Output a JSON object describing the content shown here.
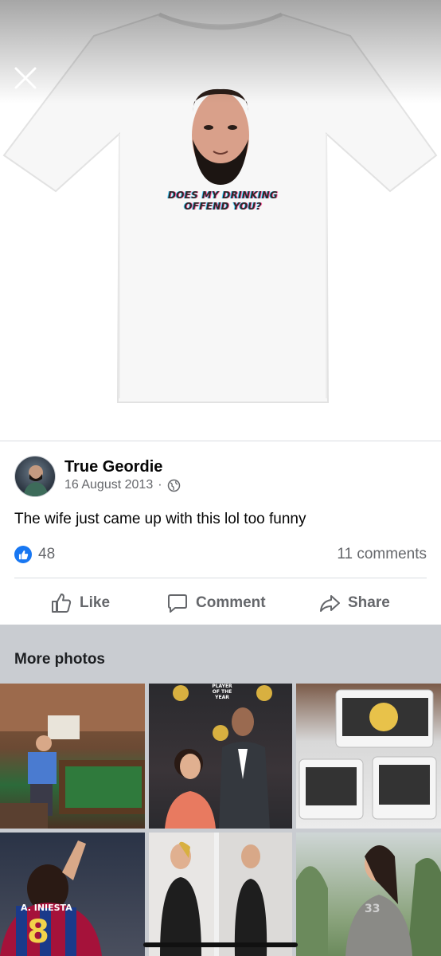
{
  "photo": {
    "shirt_text": "DOES MY DRINKING OFFEND YOU?"
  },
  "post": {
    "author": "True Geordie",
    "date": "16 August 2013",
    "separator": "·",
    "privacy_icon": "globe-icon",
    "text": "The wife just came up with this lol too funny"
  },
  "reactions": {
    "icon": "thumbs-up-icon",
    "like_count": "48",
    "comments": "11 comments"
  },
  "actions": {
    "like": "Like",
    "comment": "Comment",
    "share": "Share"
  },
  "more_photos": {
    "title": "More photos",
    "thumb2_caption": "PLAYER OF THE YEAR",
    "thumb4_caption": "A. INIESTA",
    "thumb4_number": "8",
    "thumb6_number": "33"
  },
  "colors": {
    "accent": "#1877f2",
    "secondary_text": "#65676b",
    "section_bg": "#c9ccd1"
  }
}
